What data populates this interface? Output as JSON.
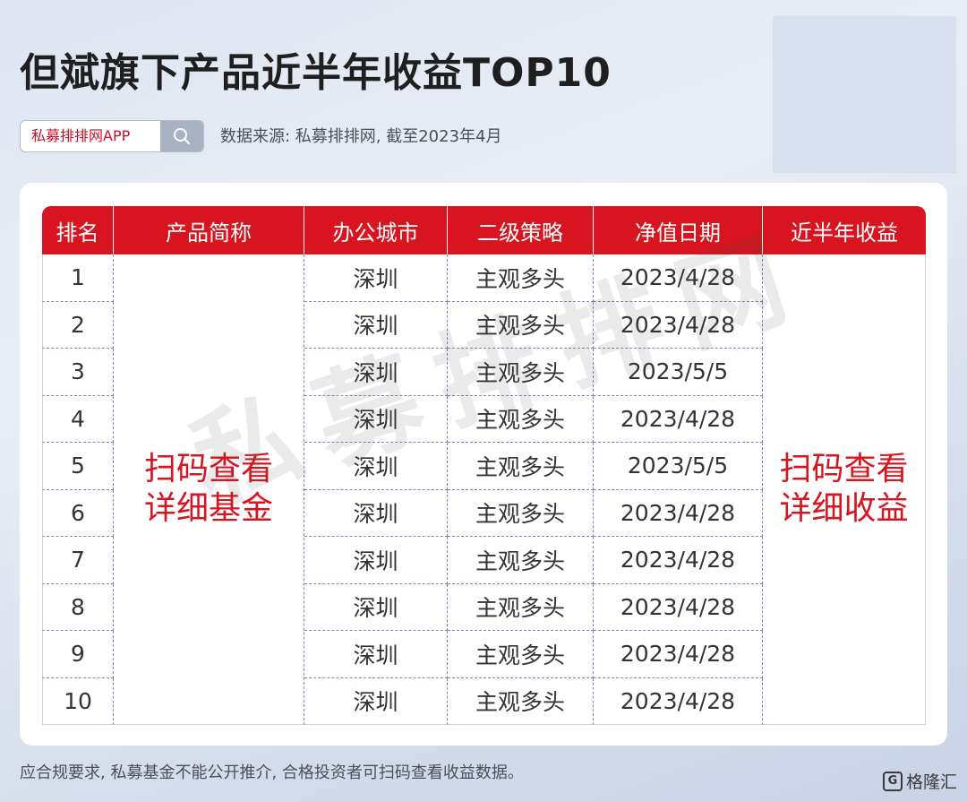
{
  "title": "但斌旗下产品近半年收益TOP10",
  "search": {
    "text": "私募排排网APP",
    "icon": "search-icon"
  },
  "source_note": "数据来源: 私募排排网, 截至2023年4月",
  "table": {
    "headers": [
      "排名",
      "产品简称",
      "办公城市",
      "二级策略",
      "净值日期",
      "近半年收益"
    ],
    "product_placeholder": [
      "扫码查看",
      "详细基金"
    ],
    "return_placeholder": [
      "扫码查看",
      "详细收益"
    ],
    "rows": [
      {
        "rank": "1",
        "city": "深圳",
        "strategy": "主观多头",
        "date": "2023/4/28"
      },
      {
        "rank": "2",
        "city": "深圳",
        "strategy": "主观多头",
        "date": "2023/4/28"
      },
      {
        "rank": "3",
        "city": "深圳",
        "strategy": "主观多头",
        "date": "2023/5/5"
      },
      {
        "rank": "4",
        "city": "深圳",
        "strategy": "主观多头",
        "date": "2023/4/28"
      },
      {
        "rank": "5",
        "city": "深圳",
        "strategy": "主观多头",
        "date": "2023/5/5"
      },
      {
        "rank": "6",
        "city": "深圳",
        "strategy": "主观多头",
        "date": "2023/4/28"
      },
      {
        "rank": "7",
        "city": "深圳",
        "strategy": "主观多头",
        "date": "2023/4/28"
      },
      {
        "rank": "8",
        "city": "深圳",
        "strategy": "主观多头",
        "date": "2023/4/28"
      },
      {
        "rank": "9",
        "city": "深圳",
        "strategy": "主观多头",
        "date": "2023/4/28"
      },
      {
        "rank": "10",
        "city": "深圳",
        "strategy": "主观多头",
        "date": "2023/4/28"
      }
    ]
  },
  "watermark": "私募排排网",
  "footer_note": "应合规要求, 私募基金不能公开推介, 合格投资者可扫码查看收益数据。",
  "brand": {
    "mark": "G",
    "name": "格隆汇"
  },
  "colors": {
    "header_red": "#d7141f",
    "accent_red": "#d7141f"
  }
}
